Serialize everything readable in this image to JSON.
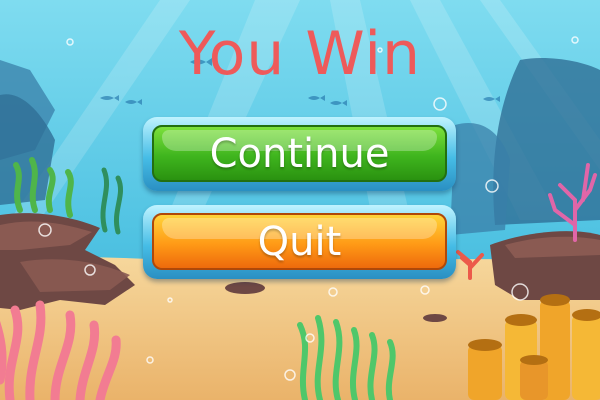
{
  "screen": {
    "title": "You Win",
    "title_color": "#ee5a5a"
  },
  "buttons": {
    "continue": {
      "label": "Continue",
      "color": "#3fb51e"
    },
    "quit": {
      "label": "Quit",
      "color": "#ff9a16"
    }
  },
  "background": {
    "theme": "underwater-reef",
    "water_color": "#5ccae6",
    "sand_color": "#f2c883"
  }
}
